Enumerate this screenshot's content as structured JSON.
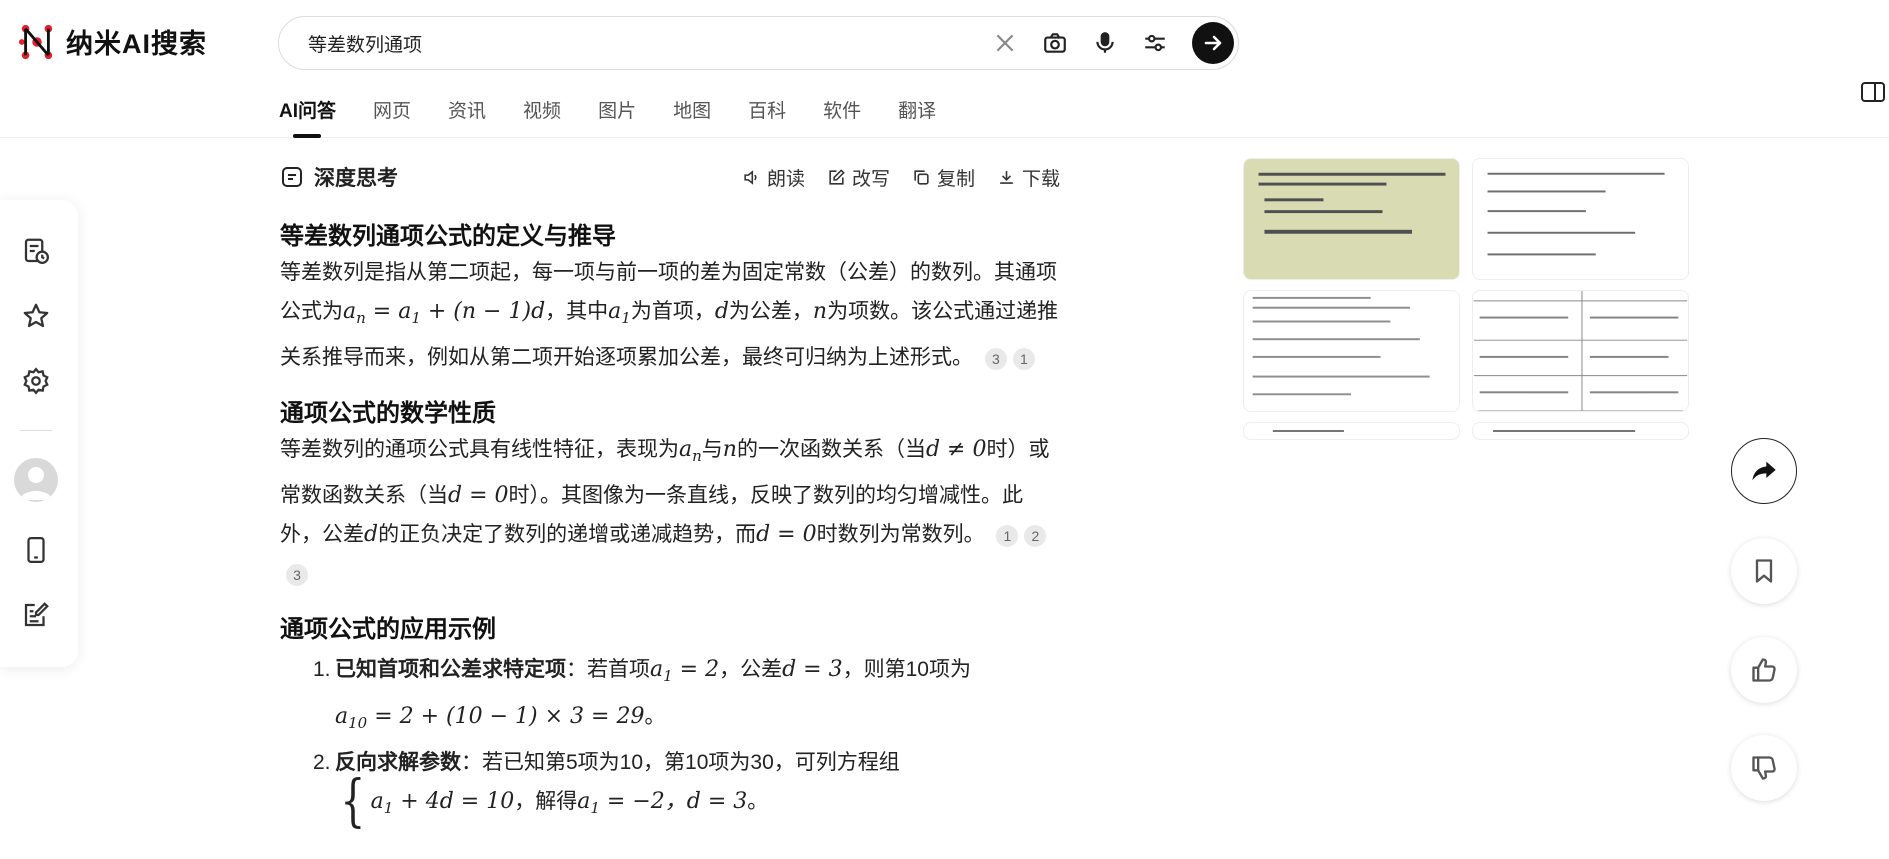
{
  "app": {
    "title": "纳米AI搜索",
    "logo_icon": "nano-logo-icon"
  },
  "search": {
    "value": "等差数列通项",
    "icons": [
      "clear-icon",
      "camera-icon",
      "microphone-icon",
      "filter-icon",
      "arrow-right-icon"
    ]
  },
  "tabs": [
    {
      "label": "AI问答",
      "active": true
    },
    {
      "label": "网页"
    },
    {
      "label": "资讯"
    },
    {
      "label": "视频"
    },
    {
      "label": "图片"
    },
    {
      "label": "地图"
    },
    {
      "label": "百科"
    },
    {
      "label": "软件"
    },
    {
      "label": "翻译"
    }
  ],
  "rail": {
    "items": [
      "history-icon",
      "star-icon",
      "gear-icon",
      "avatar",
      "phone-icon",
      "edit-note-icon"
    ]
  },
  "answer": {
    "deep_think": "深度思考",
    "actions": {
      "read": "朗读",
      "rewrite": "改写",
      "copy": "复制",
      "download": "下载"
    },
    "s1": {
      "title": "等差数列通项公式的定义与推导",
      "t1": "等差数列是指从第二项起，每一项与前一项的差为固定常数（公差）的数列。其通项公式为",
      "f1": "a",
      "f1_sub": "n",
      "f1_rest": " = a",
      "f1_sub2": "1",
      "f1_rest2": " + (n − 1)d",
      "t2": "，其中",
      "t3": "为首项，",
      "t4": "为公差，",
      "t5": "为项数。该公式通过递推关系推导而来，例如从第二项开始逐项累加公差，最终可归纳为上述形式。",
      "cites": [
        "3",
        "1"
      ]
    },
    "s2": {
      "title": "通项公式的数学性质",
      "t1": "等差数列的通项公式具有线性特征，表现为",
      "t2": "与",
      "t3": "的一次函数关系（当",
      "m1": "d ≠ 0",
      "t4": "时）或常数函数关系（当",
      "m2": "d = 0",
      "t5": "时）。其图像为一条直线，反映了数列的均匀增减性。此外，公差",
      "t6": "的正负决定了数列的递增或递减趋势，而",
      "m3": "d = 0",
      "t7": "时数列为常数列。",
      "cites": [
        "1",
        "2",
        "3"
      ]
    },
    "s3": {
      "title": "通项公式的应用示例",
      "item1_num": "1.",
      "item1_bold": "已知首项和公差求特定项",
      "item1_t1": "：若首项",
      "item1_m1": " = 2",
      "item1_t2": "，公差",
      "item1_m2": "d = 3",
      "item1_t3": "，则第10项为",
      "item1_m3_sub": "10",
      "item1_m3": " = 2 + (10 − 1) × 3 = 29",
      "item1_t4": "。",
      "item2_num": "2.",
      "item2_bold": "反向求解参数",
      "item2_t1": "：若已知第5项为10，第10项为30，可列方程组",
      "item2_eq": " + 4d = 10",
      "item2_t2": "，解得",
      "item2_m1": " = −2，",
      "item2_m2": "d = 3",
      "item2_t3": "。"
    }
  },
  "right_buttons": [
    "share-icon",
    "bookmark-icon",
    "thumbs-up-icon",
    "thumbs-down-icon"
  ],
  "colors": {
    "accent": "#111111",
    "text": "#222222",
    "muted": "#555555",
    "cite_bg": "#e9e9e9"
  }
}
